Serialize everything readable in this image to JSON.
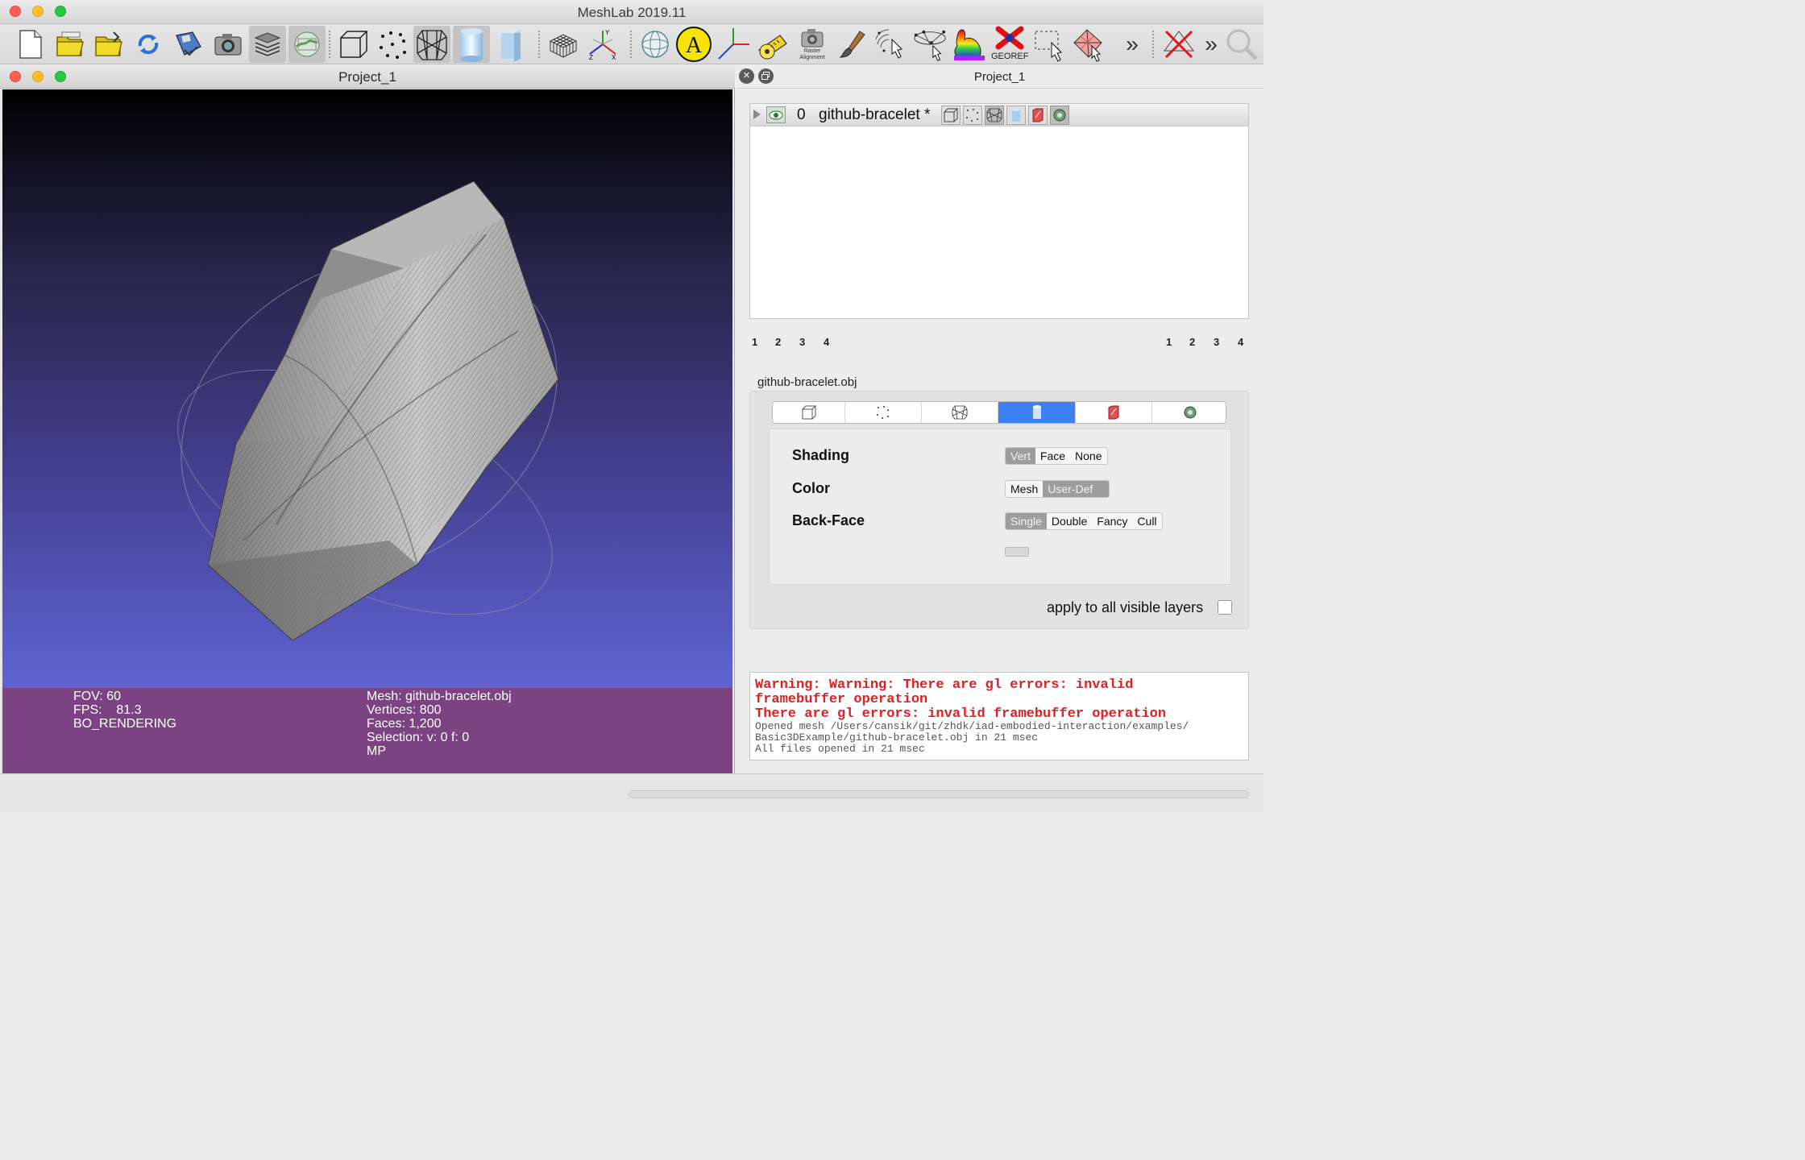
{
  "app": {
    "title": "MeshLab 2019.11"
  },
  "toolbar": {
    "icons": [
      "new-project-icon",
      "open-project-icon",
      "import-mesh-icon",
      "reload-icon",
      "save-icon",
      "snapshot-icon",
      "layers-icon",
      "raster-icon",
      "bbox-icon",
      "points-icon",
      "wireframe-icon",
      "smooth-icon",
      "flat-icon",
      "grid-icon",
      "axes-icon",
      "sphere-icon",
      "label-icon",
      "frame-icon",
      "measure-icon",
      "raster-alignment-icon",
      "paint-icon",
      "select-vertices-icon",
      "select-connected-icon",
      "color-bunny-icon",
      "georef-icon",
      "select-rect-icon",
      "select-faces-icon",
      "more-icon",
      "delete-icon",
      "search-icon"
    ],
    "label_A": "A",
    "raster_alignment_label": "Raster\nAlignment",
    "georef_label": "GEOREF",
    "overflow_glyph": "»"
  },
  "viewer": {
    "title": "Project_1",
    "info": {
      "fov": "FOV: 60",
      "fps": "FPS:    81.3",
      "mode": "BO_RENDERING",
      "mesh": "Mesh: github-bracelet.obj",
      "vertices": "Vertices: 800",
      "faces": "Faces: 1,200",
      "selection": "Selection: v: 0 f: 0",
      "mp": "MP"
    }
  },
  "dock": {
    "title": "Project_1",
    "layer": {
      "index": "0",
      "name": "github-bracelet *"
    },
    "pages_left": [
      "1",
      "2",
      "3",
      "4"
    ],
    "pages_right": [
      "1",
      "2",
      "3",
      "4"
    ],
    "file_name": "github-bracelet.obj",
    "render_tabs": [
      "bbox",
      "points",
      "wireframe",
      "smooth",
      "texture",
      "extras"
    ],
    "shading": {
      "label": "Shading",
      "options": [
        "Vert",
        "Face",
        "None"
      ],
      "selected": "Vert"
    },
    "color": {
      "label": "Color",
      "options": [
        "Mesh",
        "User-Def"
      ],
      "selected": "User-Def"
    },
    "backface": {
      "label": "Back-Face",
      "options": [
        "Single",
        "Double",
        "Fancy",
        "Cull"
      ],
      "selected": "Single"
    },
    "apply_all": "apply to all visible layers",
    "log": {
      "warn1": "Warning: Warning: There are gl errors: invalid",
      "warn2": "framebuffer operation",
      "warn3": "There are gl errors: invalid framebuffer operation",
      "line1": "Opened mesh /Users/cansik/git/zhdk/iad-embodied-interaction/examples/",
      "line2": "Basic3DExample/github-bracelet.obj in 21 msec",
      "line3": "All files opened in 21 msec"
    }
  },
  "colors": {
    "accent": "#3d82f0",
    "info_bg": "#7b4381",
    "log_red": "#e02020"
  }
}
